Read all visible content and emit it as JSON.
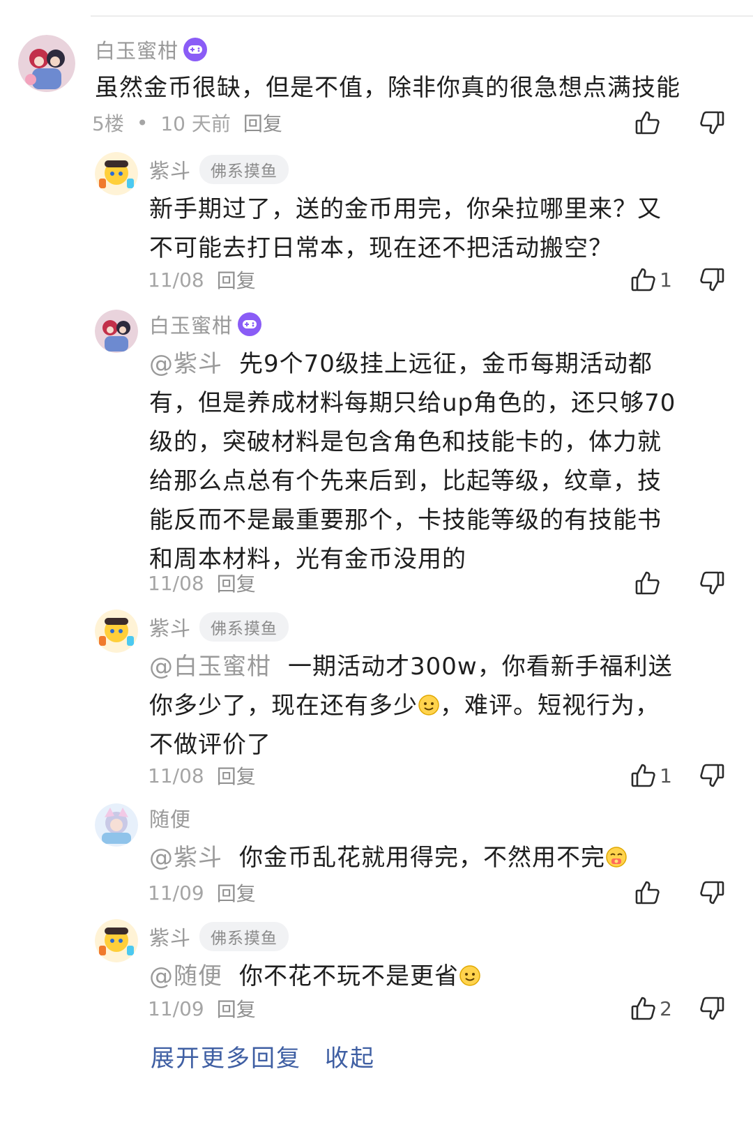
{
  "main_comment": {
    "author": "白玉蜜柑",
    "badge_icon": "game-controller-icon",
    "text": "虽然金币很缺，但是不值，除非你真的很急想点满技能",
    "floor": "5楼",
    "time": "10 天前",
    "reply_label": "回复",
    "like_count": ""
  },
  "replies": [
    {
      "author": "紫斗",
      "tag": "佛系摸鱼",
      "mention": "",
      "text": "新手期过了，送的金币用完，你朵拉哪里来？又不可能去打日常本，现在还不把活动搬空？",
      "time": "11/08",
      "reply_label": "回复",
      "like_count": "1"
    },
    {
      "author": "白玉蜜柑",
      "tag": "",
      "mention": "@紫斗",
      "text": "先9个70级挂上远征，金币每期活动都有，但是养成材料每期只给up角色的，还只够70级的，突破材料是包含角色和技能卡的，体力就给那么点总有个先来后到，比起等级，纹章，技能反而不是最重要那个，卡技能等级的有技能书和周本材料，光有金币没用的",
      "time": "11/08",
      "reply_label": "回复",
      "like_count": ""
    },
    {
      "author": "紫斗",
      "tag": "佛系摸鱼",
      "mention": "@白玉蜜柑",
      "text_a": "一期活动才300w，你看新手福利送你多少了，现在还有多少",
      "text_b": "，难评。短视行为，不做评价了",
      "emoji": "smile-emoji",
      "time": "11/08",
      "reply_label": "回复",
      "like_count": "1"
    },
    {
      "author": "随便",
      "tag": "",
      "mention": "@紫斗",
      "text": "你金币乱花就用得完，不然用不完",
      "emoji": "money-mouth-emoji",
      "time": "11/09",
      "reply_label": "回复",
      "like_count": ""
    },
    {
      "author": "紫斗",
      "tag": "佛系摸鱼",
      "mention": "@随便",
      "text": "你不花不玩不是更省",
      "emoji": "smile-emoji",
      "time": "11/09",
      "reply_label": "回复",
      "like_count": "2"
    }
  ],
  "footer": {
    "expand_label": "展开更多回复",
    "collapse_label": "收起"
  },
  "colors": {
    "link": "#3f5fa3",
    "meta": "#a5a5a5",
    "badge": "#8a5cf6"
  }
}
